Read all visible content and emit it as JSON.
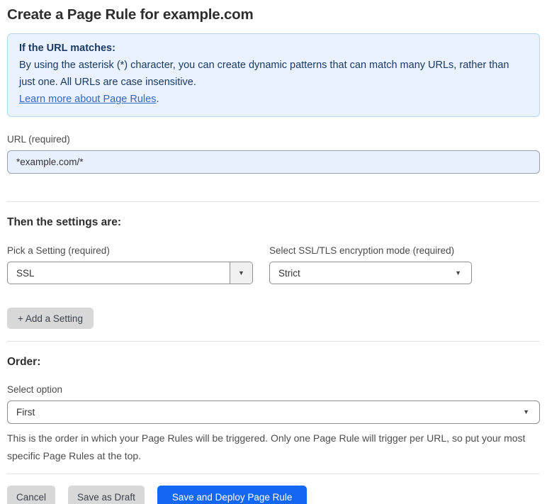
{
  "page": {
    "title": "Create a Page Rule for example.com"
  },
  "info_box": {
    "heading": "If the URL matches:",
    "body": "By using the asterisk (*) character, you can create dynamic patterns that can match many URLs, rather than just one. All URLs are case insensitive.",
    "link_label": "Learn more about Page Rules",
    "link_suffix": "."
  },
  "url_field": {
    "label": "URL (required)",
    "value": "*example.com/*"
  },
  "settings_section": {
    "heading": "Then the settings are:",
    "setting_picker": {
      "label": "Pick a Setting (required)",
      "value": "SSL"
    },
    "mode_picker": {
      "label": "Select SSL/TLS encryption mode (required)",
      "value": "Strict"
    },
    "add_setting_label": "+ Add a Setting"
  },
  "order_section": {
    "heading": "Order:",
    "label": "Select option",
    "value": "First",
    "help_text": "This is the order in which your Page Rules will be triggered. Only one Page Rule will trigger per URL, so put your most specific Page Rules at the top."
  },
  "footer": {
    "cancel_label": "Cancel",
    "save_draft_label": "Save as Draft",
    "save_deploy_label": "Save and Deploy Page Rule"
  },
  "icons": {
    "dropdown_arrow": "▼"
  },
  "colors": {
    "accent_blue": "#1467f2",
    "info_box_bg": "#e9f2fc",
    "info_box_border": "#b8d6f1",
    "info_text": "#1a3a63",
    "link_blue": "#3268c2",
    "url_input_bg": "#e8f0fe",
    "gray_button_bg": "#d8d8d8"
  }
}
